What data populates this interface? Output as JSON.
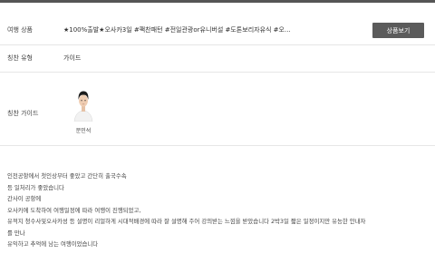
{
  "product": {
    "label": "여행 상품",
    "value": "★100%출발★오사카3일 #팩찬패턴 #전일관광or유니버설 #도톤보리자유식 #오...",
    "button_label": "상품보기"
  },
  "praise_type": {
    "label": "칭찬 유형",
    "value": "가이드"
  },
  "praise_guide": {
    "label": "칭찬 가이드",
    "guide_name": "문민석"
  },
  "review": {
    "lines": [
      "인천공항에서 첫인상부터 좋았고 간단히 출국수속",
      "등 일처리가 좋았습니다",
      "간사이 공항에",
      "오사카에 도착하여 여행일정에 따라 여행이 진행되었고,",
      "유적지 청수사및오사카성 등 설명이 리얼하게 시대적배경에 따라 잘 설명해 주어 강의받는 느낌을 받았습니다 2박3일 짧은 일정이지만 유능한 안내자",
      "를 만나",
      "유익하고 추억에 남는 여행이었습니다"
    ]
  }
}
